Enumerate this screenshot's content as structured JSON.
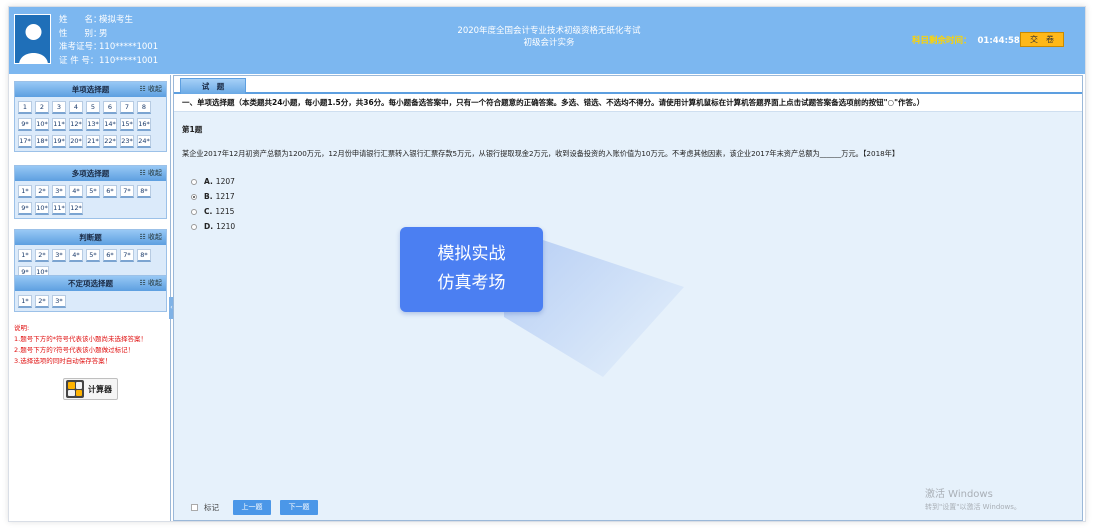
{
  "candidate": {
    "rows": [
      {
        "key": "姓　　名：",
        "val": "模拟考生"
      },
      {
        "key": "性　　别：",
        "val": "男"
      },
      {
        "key": "准考证号：",
        "val": "110*****1001"
      },
      {
        "key": "证 件 号：",
        "val": "110*****1001"
      }
    ]
  },
  "exam": {
    "title": "2020年度全国会计专业技术初级资格无纸化考试",
    "subject": "初级会计实务"
  },
  "timer": {
    "label": "科目剩余时间：",
    "time": "01:44:58"
  },
  "submit_label": "交　卷",
  "sections": [
    {
      "title": "单项选择题",
      "collapse": "☷ 收起",
      "questions": [
        "1",
        "2",
        "3",
        "4",
        "5",
        "6",
        "7",
        "8",
        "9*",
        "10*",
        "11*",
        "12*",
        "13*",
        "14*",
        "15*",
        "16*",
        "17*",
        "18*",
        "19*",
        "20*",
        "21*",
        "22*",
        "23*",
        "24*"
      ]
    },
    {
      "title": "多项选择题",
      "collapse": "☷ 收起",
      "questions": [
        "1*",
        "2*",
        "3*",
        "4*",
        "5*",
        "6*",
        "7*",
        "8*",
        "9*",
        "10*",
        "11*",
        "12*"
      ]
    },
    {
      "title": "判断题",
      "collapse": "☷ 收起",
      "questions": [
        "1*",
        "2*",
        "3*",
        "4*",
        "5*",
        "6*",
        "7*",
        "8*",
        "9*",
        "10*"
      ]
    },
    {
      "title": "不定项选择题",
      "collapse": "☷ 收起",
      "questions": [
        "1*",
        "2*",
        "3*"
      ]
    }
  ],
  "notes": {
    "title": "说明:",
    "items": [
      "1.题号下方的*符号代表该小题尚未选择答案！",
      "2.题号下方的?符号代表该小题做过标记！",
      "3.选择选项的同时自动保存答案！"
    ]
  },
  "calculator_label": "计算器",
  "tab_label": "试　题",
  "instruction": "一、单项选择题（本类题共24小题，每小题1.5分，共36分。每小题备选答案中，只有一个符合题意的正确答案。多选、错选、不选均不得分。请使用计算机鼠标在计算机答题界面上点击试题答案备选项前的按钮\"○\"作答。）",
  "question": {
    "number": "第1题",
    "stem": "某企业2017年12月初资产总额为1200万元，12月份申请银行汇票转入银行汇票存款5万元，从银行提取现金2万元，收到设备投资的入账价值为10万元。不考虑其他因素，该企业2017年末资产总额为______万元。【2018年】",
    "options": [
      {
        "letter": "A.",
        "text": "1207",
        "selected": false
      },
      {
        "letter": "B.",
        "text": "1217",
        "selected": true
      },
      {
        "letter": "C.",
        "text": "1215",
        "selected": false
      },
      {
        "letter": "D.",
        "text": "1210",
        "selected": false
      }
    ]
  },
  "promo": {
    "line1": "模拟实战",
    "line2": "仿真考场"
  },
  "bottom": {
    "mark_label": "标记",
    "prev_label": "上一题",
    "next_label": "下一题"
  },
  "watermark": {
    "line1": "激活 Windows",
    "line2": "转到\"设置\"以激活 Windows。"
  }
}
